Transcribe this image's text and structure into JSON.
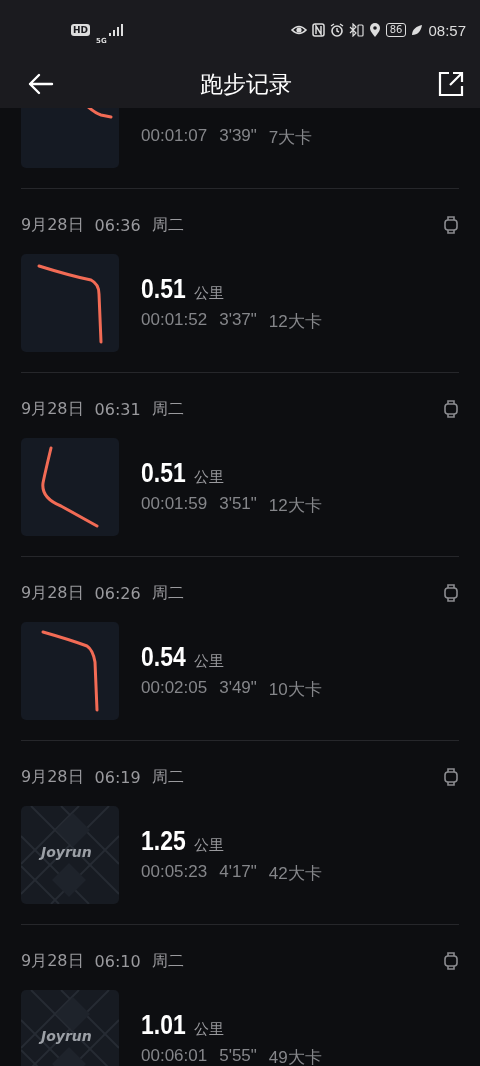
{
  "status_bar": {
    "hd": "HD",
    "network": "5G",
    "battery": "86",
    "time": "08:57"
  },
  "app_bar": {
    "title": "跑步记录"
  },
  "runs": [
    {
      "kind": "partial",
      "thumbnail": {
        "kind": "route"
      },
      "duration": "00:01:07",
      "pace": "3'39\"",
      "calories": "7大卡"
    },
    {
      "kind": "full",
      "date": "9月28日",
      "time": "06:36",
      "weekday": "周二",
      "thumbnail": {
        "kind": "route"
      },
      "distance": "0.51",
      "unit": "公里",
      "duration": "00:01:52",
      "pace": "3'37\"",
      "calories": "12大卡"
    },
    {
      "kind": "full",
      "date": "9月28日",
      "time": "06:31",
      "weekday": "周二",
      "thumbnail": {
        "kind": "route"
      },
      "distance": "0.51",
      "unit": "公里",
      "duration": "00:01:59",
      "pace": "3'51\"",
      "calories": "12大卡"
    },
    {
      "kind": "full",
      "date": "9月28日",
      "time": "06:26",
      "weekday": "周二",
      "thumbnail": {
        "kind": "route"
      },
      "distance": "0.54",
      "unit": "公里",
      "duration": "00:02:05",
      "pace": "3'49\"",
      "calories": "10大卡"
    },
    {
      "kind": "full",
      "date": "9月28日",
      "time": "06:19",
      "weekday": "周二",
      "thumbnail": {
        "kind": "logo",
        "text": "Joyrun"
      },
      "distance": "1.25",
      "unit": "公里",
      "duration": "00:05:23",
      "pace": "4'17\"",
      "calories": "42大卡"
    },
    {
      "kind": "full",
      "date": "9月28日",
      "time": "06:10",
      "weekday": "周二",
      "thumbnail": {
        "kind": "logo",
        "text": "Joyrun"
      },
      "distance": "1.01",
      "unit": "公里",
      "duration": "00:06:01",
      "pace": "5'55\"",
      "calories": "49大卡"
    }
  ]
}
